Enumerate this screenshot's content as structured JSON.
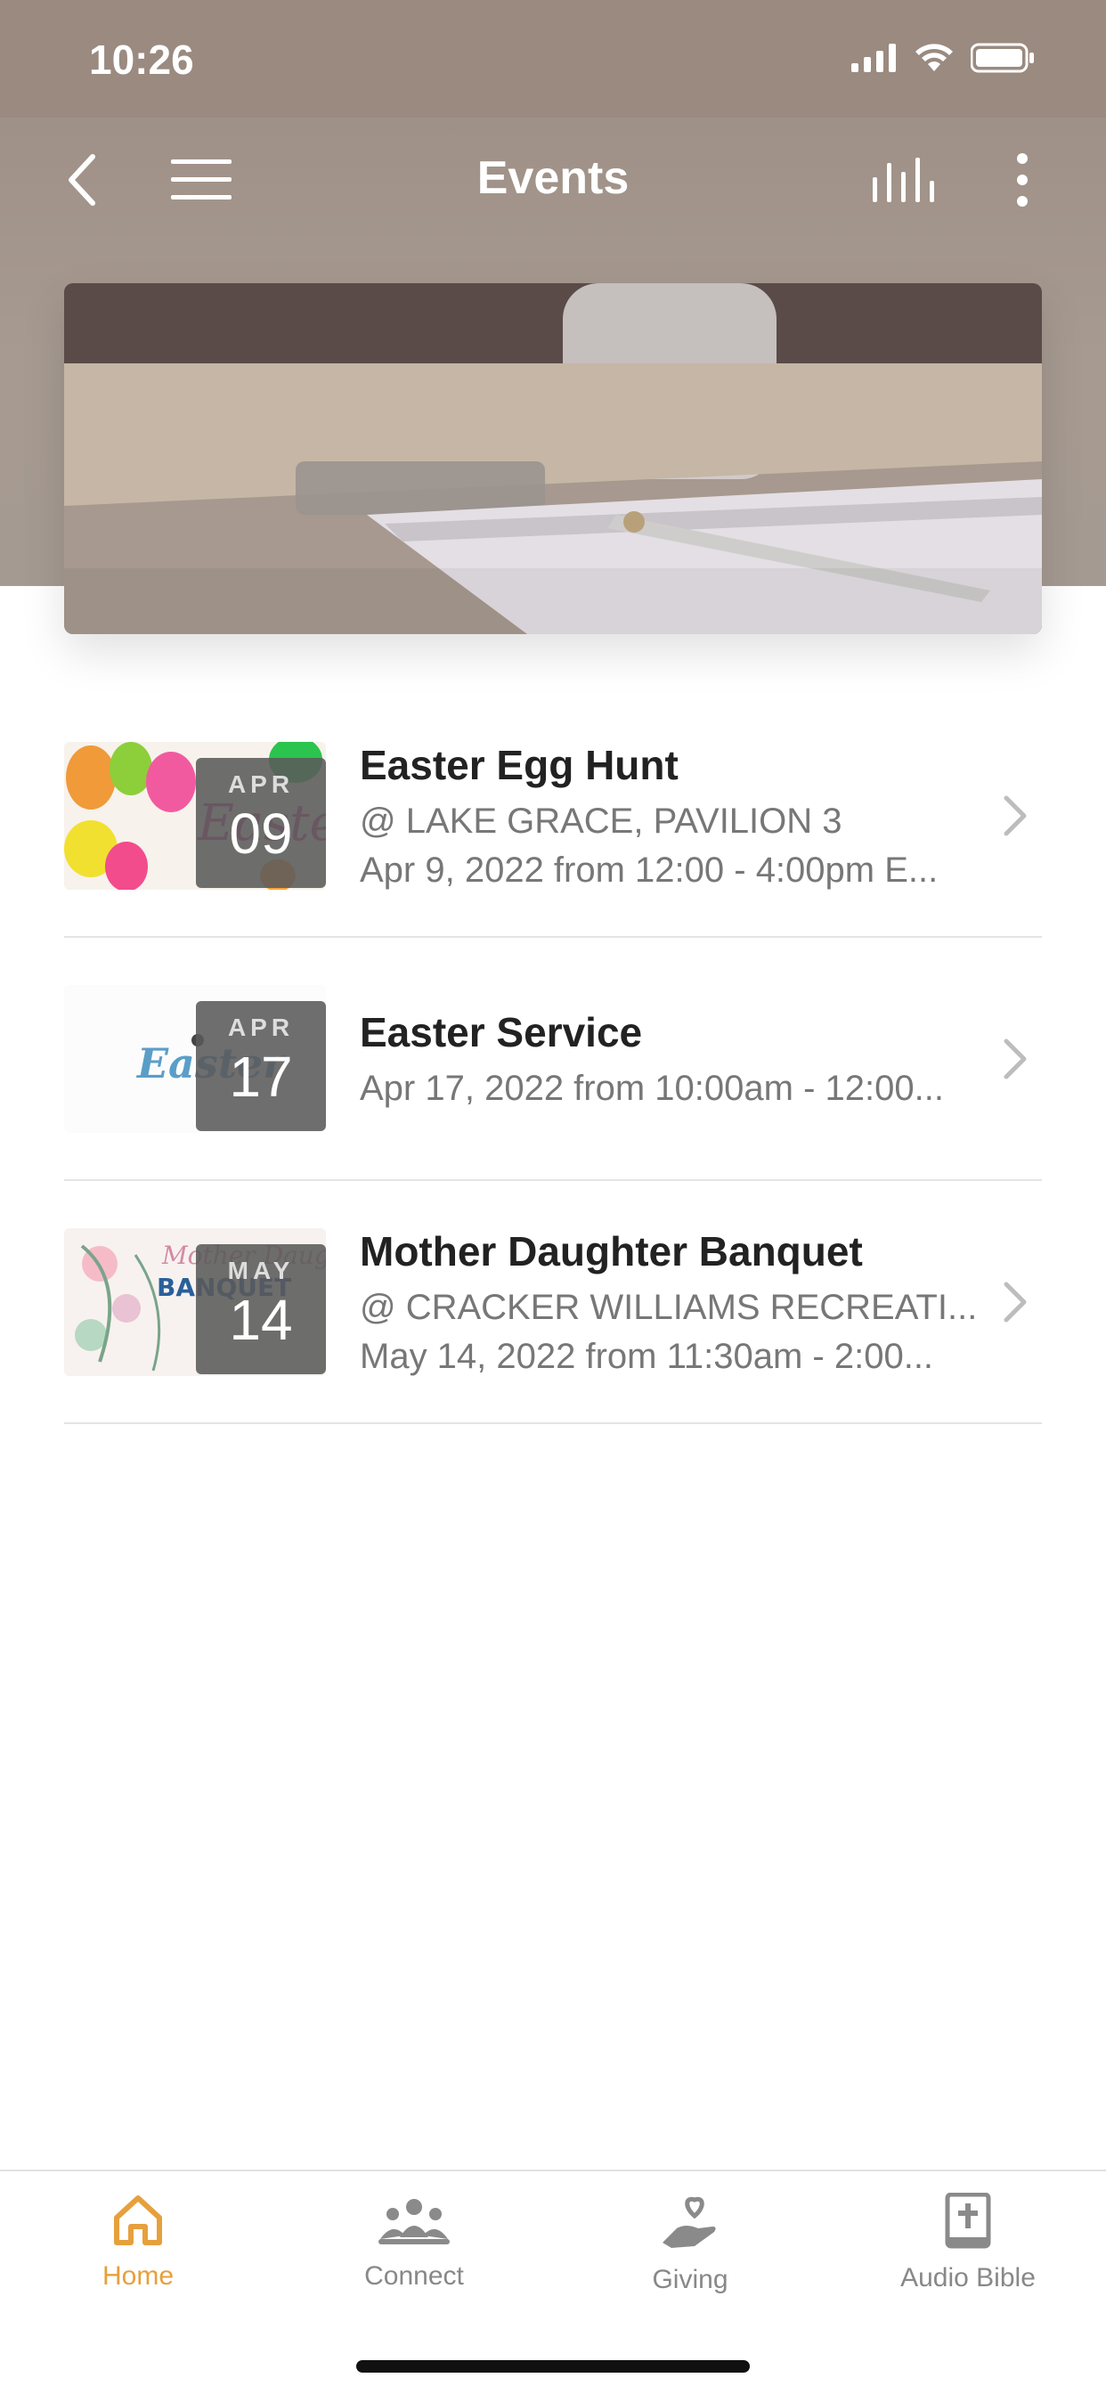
{
  "status": {
    "time": "10:26"
  },
  "nav": {
    "title": "Events"
  },
  "events": [
    {
      "title": "Easter Egg Hunt",
      "location": "@ LAKE GRACE, PAVILION 3",
      "when": "Apr 9, 2022 from 12:00 - 4:00pm E...",
      "month": "APR",
      "day": "09"
    },
    {
      "title": "Easter Service",
      "when": "Apr 17, 2022 from 10:00am - 12:00...",
      "month": "APR",
      "day": "17"
    },
    {
      "title": "Mother Daughter Banquet",
      "location": "@ CRACKER WILLIAMS RECREATI...",
      "when": "May 14, 2022 from 11:30am - 2:00...",
      "month": "MAY",
      "day": "14"
    }
  ],
  "tabs": [
    {
      "label": "Home",
      "icon": "home-icon"
    },
    {
      "label": "Connect",
      "icon": "people-icon"
    },
    {
      "label": "Giving",
      "icon": "hand-heart-icon"
    },
    {
      "label": "Audio Bible",
      "icon": "bible-icon"
    }
  ],
  "colors": {
    "accent": "#e6a03c",
    "header": "#9c8c82"
  }
}
